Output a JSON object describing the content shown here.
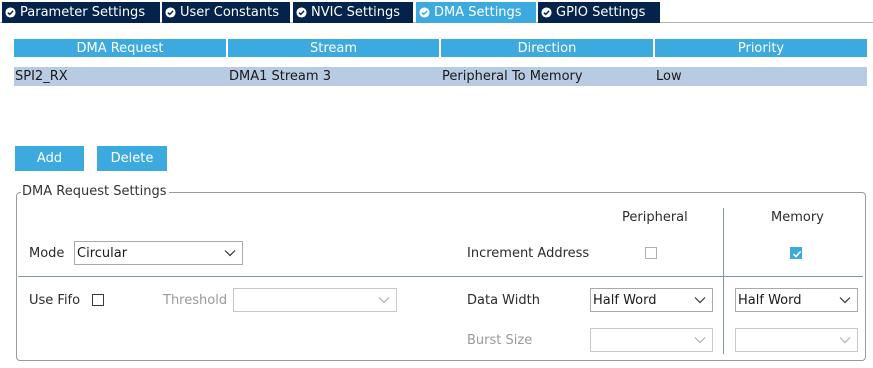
{
  "tabs": [
    {
      "label": "Parameter Settings",
      "active": false
    },
    {
      "label": "User Constants",
      "active": false
    },
    {
      "label": "NVIC Settings",
      "active": false
    },
    {
      "label": "DMA Settings",
      "active": true
    },
    {
      "label": "GPIO Settings",
      "active": false
    }
  ],
  "table": {
    "headers": [
      "DMA Request",
      "Stream",
      "Direction",
      "Priority"
    ],
    "rows": [
      [
        "SPI2_RX",
        "DMA1 Stream 3",
        "Peripheral To Memory",
        "Low"
      ]
    ]
  },
  "buttons": {
    "add": "Add",
    "delete": "Delete"
  },
  "settings": {
    "title": "DMA Request Settings",
    "peripheral_header": "Peripheral",
    "memory_header": "Memory",
    "mode_label": "Mode",
    "mode_value": "Circular",
    "increment_label": "Increment Address",
    "peripheral_increment": false,
    "memory_increment": true,
    "use_fifo_label": "Use Fifo",
    "use_fifo": false,
    "threshold_label": "Threshold",
    "threshold_value": "",
    "data_width_label": "Data Width",
    "peripheral_data_width": "Half Word",
    "memory_data_width": "Half Word",
    "burst_size_label": "Burst Size",
    "peripheral_burst": "",
    "memory_burst": ""
  },
  "colors": {
    "tab_bg": "#03234b",
    "accent": "#3caadf",
    "row_selected": "#b7cbe3"
  }
}
